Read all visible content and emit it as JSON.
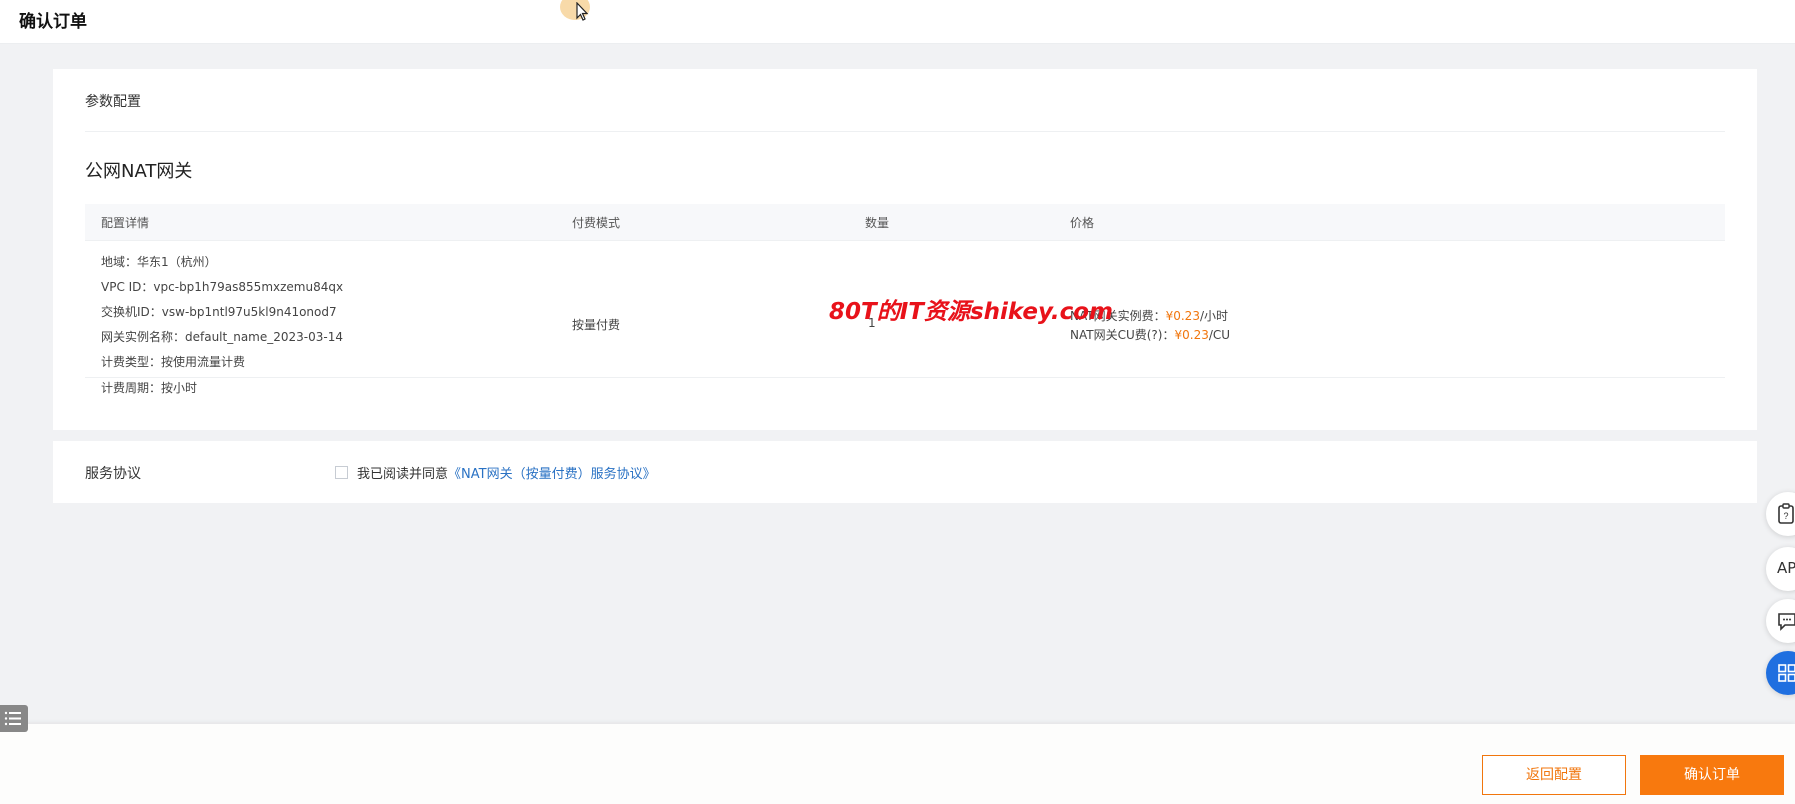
{
  "header": {
    "title": "确认订单"
  },
  "config_card": {
    "section_label": "参数配置",
    "product_title": "公网NAT网关",
    "columns": [
      "配置详情",
      "付费模式",
      "数量",
      "价格"
    ],
    "details": [
      "地域：华东1（杭州）",
      "VPC ID：vpc-bp1h79as855mxzemu84qx",
      "交换机ID：vsw-bp1ntl97u5kl9n41onod7",
      "网关实例名称：default_name_2023-03-14",
      "计费类型：按使用流量计费",
      "计费周期：按小时"
    ],
    "billing_mode": "按量付费",
    "quantity": "1",
    "prices": [
      {
        "label": "NAT网关实例费：",
        "amount": "¥0.23",
        "unit": "/小时"
      },
      {
        "label": "NAT网关CU费(?)：",
        "amount": "¥0.23",
        "unit": "/CU"
      }
    ]
  },
  "watermark": "80T的IT资源shikey.com",
  "agreement": {
    "label": "服务协议",
    "text": "我已阅读并同意",
    "link": "《NAT网关（按量付费）服务协议》",
    "checked": false
  },
  "side_tools": {
    "api_label": "API"
  },
  "footer": {
    "back_label": "返回配置",
    "confirm_label": "确认订单"
  },
  "colors": {
    "accent": "#f8790e",
    "link": "#2a72c4",
    "watermark": "#e8121a",
    "tool_blue": "#1f6fe0"
  }
}
